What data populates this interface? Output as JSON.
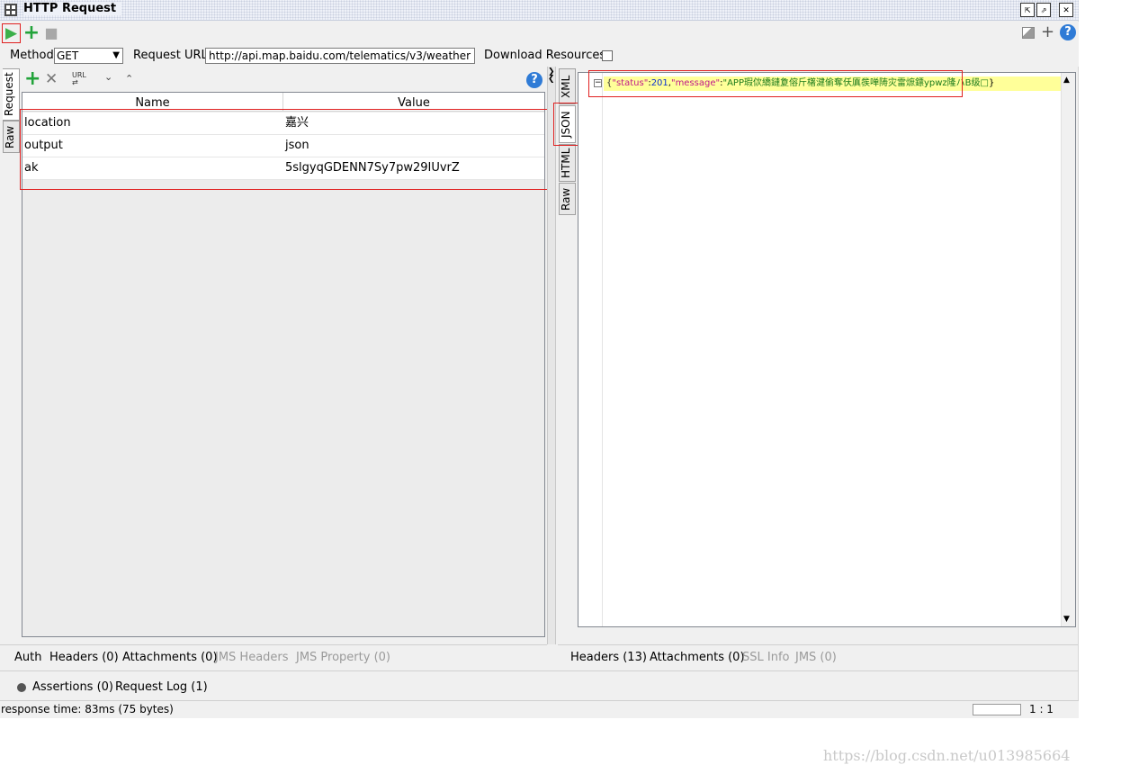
{
  "window": {
    "title": "HTTP Request",
    "icons": [
      "grid-icon",
      "restore-icon",
      "maximize-icon",
      "close-icon"
    ]
  },
  "toolbar": {
    "run_icon": "▶",
    "add_icon": "+",
    "stop_icon": "■",
    "right_icons": [
      "filter-icon",
      "add-icon",
      "help-icon"
    ]
  },
  "method_row": {
    "method_label": "Method",
    "method_value": "GET",
    "url_label": "Request URL:",
    "url_value": "http://api.map.baidu.com/telematics/v3/weather",
    "download_label": "Download Resources"
  },
  "left_tabs": [
    "Request",
    "Raw"
  ],
  "params": {
    "columns": [
      "Name",
      "Value"
    ],
    "rows": [
      {
        "name": "location",
        "value": "嘉兴"
      },
      {
        "name": "output",
        "value": "json"
      },
      {
        "name": "ak",
        "value": "5slgyqGDENN7Sy7pw29IUvrZ"
      }
    ]
  },
  "right_tabs": [
    "XML",
    "JSON",
    "HTML",
    "Raw"
  ],
  "response": {
    "brace_open": "{",
    "key_status": "\"status\"",
    "colon1": ":",
    "val_status": "201",
    "comma": ",",
    "key_message": "\"message\"",
    "colon2": ":",
    "val_message": "\"APP瑕佽繑鏈夐傛斤櫡湕偷奪仸厧彂啴陦灾雷熫鏢ypwz隆ハB级□",
    "brace_close": "}"
  },
  "left_bottom_tabs": [
    {
      "label": "Auth",
      "disabled": false
    },
    {
      "label": "Headers (0)",
      "disabled": false
    },
    {
      "label": "Attachments (0)",
      "disabled": false
    },
    {
      "label": "JMS Headers",
      "disabled": true
    },
    {
      "label": "JMS Property (0)",
      "disabled": true
    }
  ],
  "right_bottom_tabs": [
    {
      "label": "Headers (13)",
      "disabled": false
    },
    {
      "label": "Attachments (0)",
      "disabled": false
    },
    {
      "label": "SSL Info",
      "disabled": true
    },
    {
      "label": "JMS (0)",
      "disabled": true
    }
  ],
  "assertions": {
    "assertions_label": "Assertions (0)",
    "log_label": "Request Log (1)"
  },
  "status": {
    "response_time": "response time: 83ms (75 bytes)",
    "position": "1 : 1"
  },
  "watermark": "https://blog.csdn.net/u013985664"
}
